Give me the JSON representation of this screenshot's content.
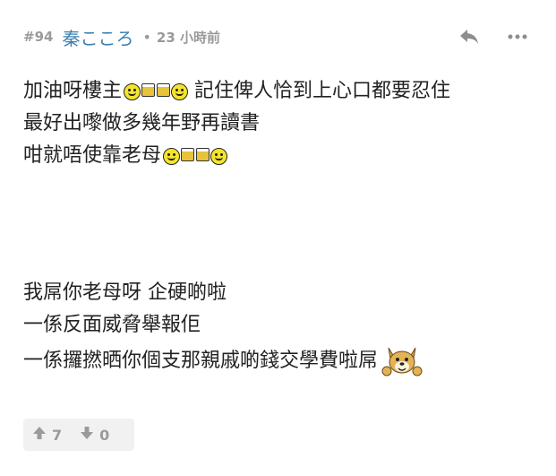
{
  "post": {
    "number": "#94",
    "username": "秦こころ",
    "separator": "•",
    "time": "23 小時前"
  },
  "content": {
    "lines_top": [
      {
        "text_before": "加油呀樓主",
        "text_after": " 記住俾人恰到上心口都要忍住",
        "emotes": "smile-beer-beer-smile"
      },
      {
        "text": "最好出嚟做多幾年野再讀書"
      },
      {
        "text": "咁就唔使靠老母",
        "emotes": "smile-beer-beer-smile"
      }
    ],
    "lines_bottom": [
      {
        "text": "我屌你老母呀 企硬啲啦"
      },
      {
        "text": "一係反面威脅舉報佢"
      },
      {
        "text": "一係攞撚晒你個支那親戚啲錢交學費啦屌",
        "emote": "dog"
      }
    ]
  },
  "votes": {
    "up_count": "7",
    "down_count": "0"
  },
  "icons": {
    "reply": "reply-icon",
    "more": "more-icon",
    "upvote": "arrow-up-icon",
    "downvote": "arrow-down-icon"
  },
  "colors": {
    "username": "#3d7fae",
    "meta": "#9a9a9a",
    "vote_bg": "#f1f1f1"
  }
}
